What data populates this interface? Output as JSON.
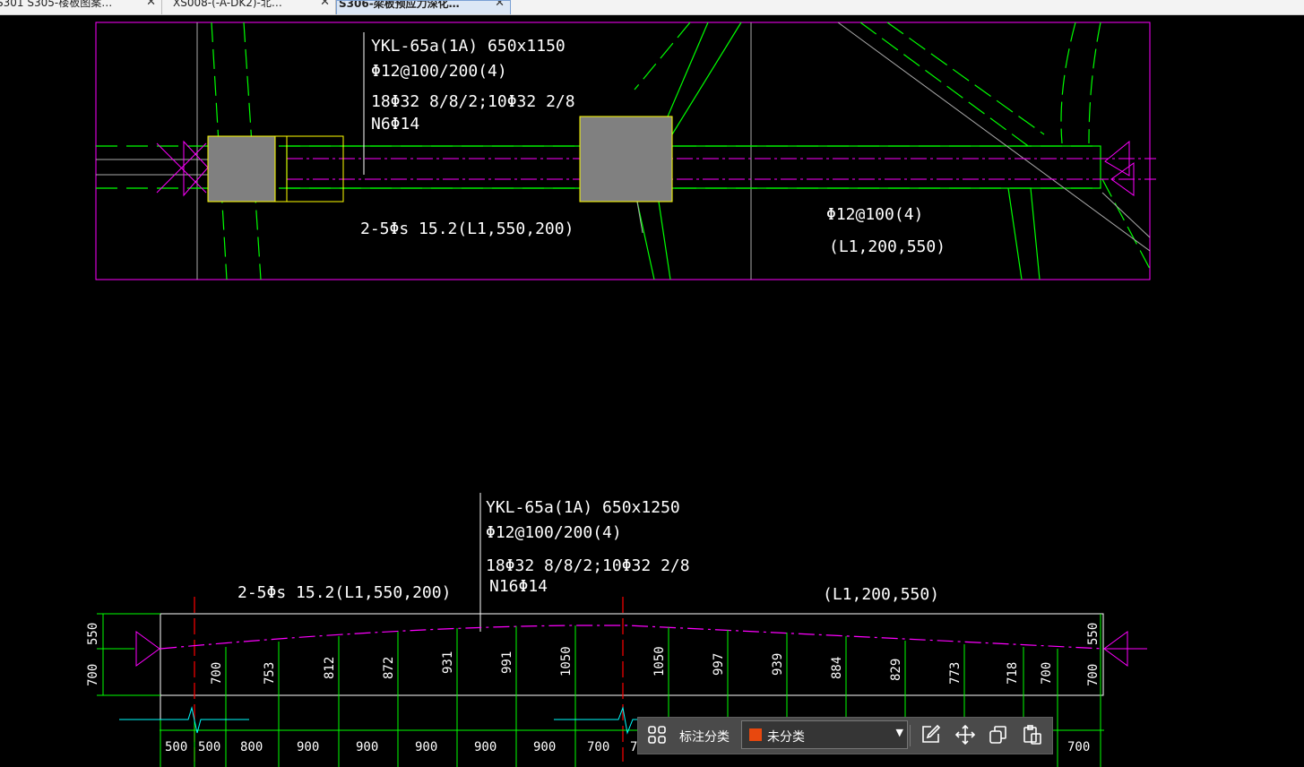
{
  "tabs": [
    {
      "label": "S301 S305-楼板图案…",
      "close": "✕",
      "active": false
    },
    {
      "label": "XS008-(-A-DK2)-北…",
      "close": "✕",
      "active": false
    },
    {
      "label": "S306-梁板预应力深化…",
      "close": "✕",
      "active": true
    }
  ],
  "drawing": {
    "plan": {
      "beam_title": "YKL-65a(1A) 650x1150",
      "stirrup": "Φ12@100/200(4)",
      "main_bars": "18Φ32 8/8/2;10Φ32 2/8",
      "side_bars": "N6Φ14",
      "tendon": "2-5Φs 15.2(L1,550,200)",
      "stirrup_right": "Φ12@100(4)",
      "tendon_right": "(L1,200,550)"
    },
    "elevation": {
      "beam_title": "YKL-65a(1A) 650x1250",
      "stirrup": "Φ12@100/200(4)",
      "main_bars": "18Φ32 8/8/2;10Φ32 2/8",
      "side_bars": "N16Φ14",
      "tendon": "2-5Φs 15.2(L1,550,200)",
      "tendon_right": "(L1,200,550)",
      "left_dims": [
        "550",
        "700"
      ],
      "right_dims": [
        "550",
        "700"
      ],
      "profile_heights": [
        "700",
        "753",
        "812",
        "872",
        "931",
        "991",
        "1050",
        "1050",
        "997",
        "939",
        "884",
        "829",
        "773",
        "718",
        "700"
      ],
      "spacing_dims": [
        "500",
        "500",
        "800",
        "900",
        "900",
        "900",
        "900",
        "900",
        "700",
        "7",
        "700"
      ]
    }
  },
  "toolbar": {
    "grid_icon": "grid-icon",
    "label": "标注分类",
    "select_value": "未分类",
    "select_color": "#e8480e",
    "edit_icon": "edit-icon",
    "move_icon": "move-icon",
    "copy_icon": "copy-icon",
    "paste_icon": "paste-icon"
  },
  "colors": {
    "background": "#000000",
    "magenta": "#ff00ff",
    "green": "#00ff00",
    "yellow": "#ffff00",
    "column_fill": "#808080",
    "red": "#ff0000",
    "cyan": "#00ffff"
  }
}
